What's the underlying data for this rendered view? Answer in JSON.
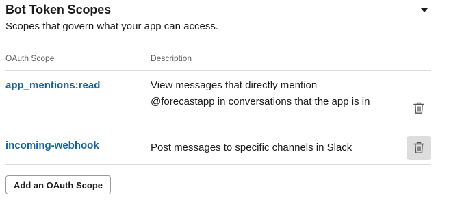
{
  "section": {
    "title": "Bot Token Scopes",
    "subtitle": "Scopes that govern what your app can access.",
    "toggle_icon": "caret-down-icon"
  },
  "table": {
    "headers": {
      "scope": "OAuth Scope",
      "description": "Description"
    },
    "rows": [
      {
        "scope": "app_mentions:read",
        "description": "View messages that directly mention @forecastapp in conversations that the app is in",
        "action_icon": "trash-icon"
      },
      {
        "scope": "incoming-webhook",
        "description": "Post messages to specific channels in Slack",
        "action_icon": "trash-icon"
      }
    ]
  },
  "actions": {
    "add_scope_label": "Add an OAuth Scope"
  },
  "colors": {
    "link": "#1264a3",
    "text": "#1d1c1d",
    "muted": "#616061",
    "divider": "#dddddd",
    "hover_bg": "#dddddd"
  }
}
